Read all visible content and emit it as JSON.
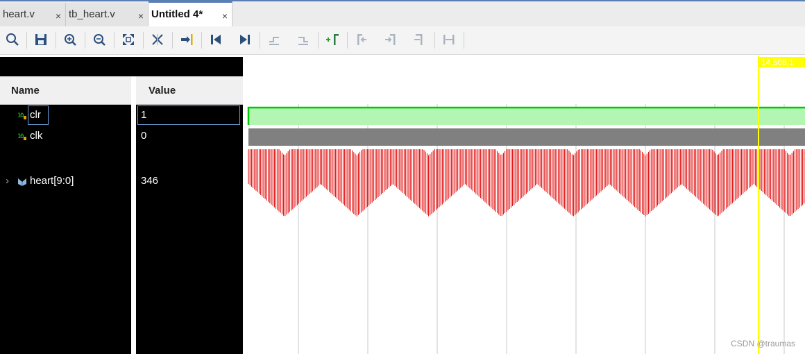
{
  "tabs": [
    {
      "label": "heart.v",
      "close": "×"
    },
    {
      "label": "tb_heart.v",
      "close": "×"
    },
    {
      "label": "Untitled 4*",
      "close": "×"
    }
  ],
  "toolbar": {
    "buttons": [
      "search-icon",
      "save-icon",
      "zoom-in-icon",
      "zoom-out-icon",
      "zoom-fit-icon",
      "cursor-to-zero-icon",
      "go-to-time-zero-icon",
      "go-to-start-icon",
      "go-to-end-icon",
      "previous-transition-icon",
      "next-transition-icon",
      "add-marker-icon",
      "previous-marker-icon",
      "next-marker-icon",
      "swap-cursors-icon",
      "snap-icon"
    ]
  },
  "columns": {
    "name": "Name",
    "value": "Value"
  },
  "signals": [
    {
      "name": "clr",
      "value": "1",
      "icon": "bit-signal-icon"
    },
    {
      "name": "clk",
      "value": "0",
      "icon": "bit-signal-icon"
    },
    {
      "name": "heart[9:0]",
      "value": "346",
      "icon": "bus-signal-icon",
      "expand": "›"
    }
  ],
  "cursor": {
    "time": "14,508,1"
  },
  "colors": {
    "clr_wave": "#00c800",
    "clr_fill": "#b3f5b3",
    "clk_wave": "#808080",
    "heart_wave": "#e00000",
    "cursor": "#ffff00"
  },
  "watermark": "CSDN @traumas"
}
